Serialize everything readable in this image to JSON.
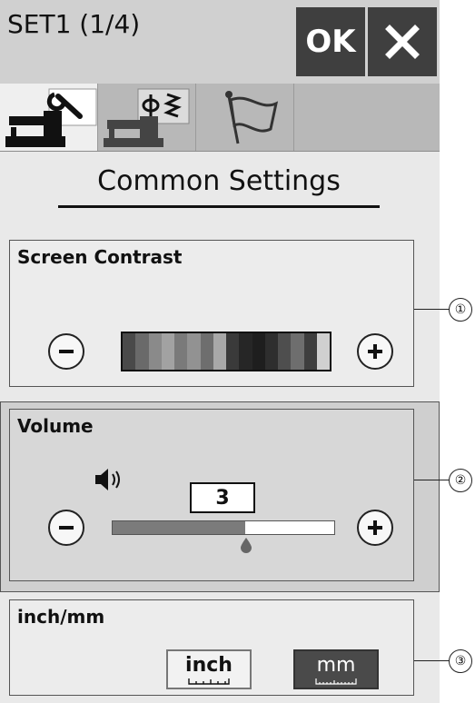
{
  "header": {
    "title": "SET1 (1/4)",
    "ok_label": "OK",
    "close_icon": "close-icon"
  },
  "tabs": [
    {
      "name": "common-settings",
      "icon": "wrench-machine-icon",
      "active": true
    },
    {
      "name": "sewing-settings",
      "icon": "presser-foot-machine-icon",
      "active": false
    },
    {
      "name": "language-settings",
      "icon": "flag-icon",
      "active": false
    }
  ],
  "main": {
    "heading": "Common Settings",
    "contrast": {
      "label": "Screen Contrast",
      "minus_icon": "minus-icon",
      "plus_icon": "plus-icon",
      "colors": [
        "#4a4a4a",
        "#6a6a6a",
        "#8a8a8a",
        "#a2a2a2",
        "#7a7a7a",
        "#929292",
        "#6e6e6e",
        "#a8a8a8",
        "#3a3a3a",
        "#262626",
        "#1e1e1e",
        "#2e2e2e",
        "#4e4e4e",
        "#6e6e6e",
        "#3e3e3e",
        "#d0d0d0"
      ]
    },
    "volume": {
      "label": "Volume",
      "value": "3",
      "level_fraction": 0.6,
      "speaker_icon": "speaker-icon",
      "minus_icon": "minus-icon",
      "plus_icon": "plus-icon"
    },
    "units": {
      "label": "inch/mm",
      "inch_label": "inch",
      "mm_label": "mm",
      "selected": "mm"
    }
  },
  "callouts": [
    "①",
    "②",
    "③"
  ]
}
